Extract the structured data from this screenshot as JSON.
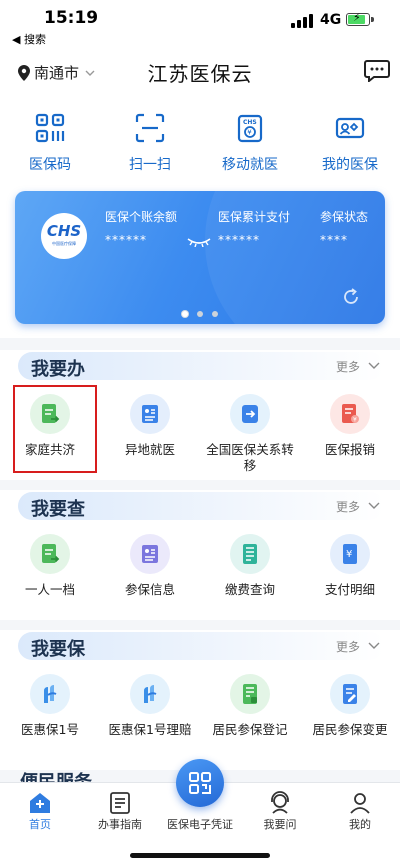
{
  "status_bar": {
    "time": "15:19",
    "back_label": "◀ 搜索",
    "network": "4G"
  },
  "header": {
    "city": "南通市",
    "title": "江苏医保云"
  },
  "quick_actions": [
    {
      "label": "医保码",
      "icon": "qr-code-icon"
    },
    {
      "label": "扫一扫",
      "icon": "scan-icon"
    },
    {
      "label": "移动就医",
      "icon": "mobile-medical-icon"
    },
    {
      "label": "我的医保",
      "icon": "insurance-card-icon"
    }
  ],
  "card": {
    "logo_text": "CHS",
    "logo_sub": "中国医疗保障",
    "columns": [
      {
        "label": "医保个账余额",
        "value": "******"
      },
      {
        "label": "医保累计支付",
        "value": "******"
      },
      {
        "label": "参保状态",
        "value": "****"
      }
    ],
    "page_count": 3,
    "active_page": 1
  },
  "sections": [
    {
      "title": "我要办",
      "more": "更多",
      "items": [
        {
          "label": "家庭共济",
          "icon": "family-mutual-aid-icon",
          "highlighted": true
        },
        {
          "label": "异地就医",
          "icon": "remote-medical-icon"
        },
        {
          "label": "全国医保关系转移",
          "icon": "transfer-icon"
        },
        {
          "label": "医保报销",
          "icon": "reimbursement-icon"
        }
      ]
    },
    {
      "title": "我要查",
      "more": "更多",
      "items": [
        {
          "label": "一人一档",
          "icon": "personal-file-icon"
        },
        {
          "label": "参保信息",
          "icon": "insurance-info-icon"
        },
        {
          "label": "缴费查询",
          "icon": "payment-query-icon"
        },
        {
          "label": "支付明细",
          "icon": "payment-detail-icon"
        }
      ]
    },
    {
      "title": "我要保",
      "more": "更多",
      "items": [
        {
          "label": "医惠保1号",
          "icon": "yihuibao-icon"
        },
        {
          "label": "医惠保1号理赔",
          "icon": "yihuibao-claim-icon"
        },
        {
          "label": "居民参保登记",
          "icon": "resident-register-icon"
        },
        {
          "label": "居民参保变更",
          "icon": "resident-change-icon"
        }
      ]
    }
  ],
  "service_peek": "便民服务",
  "bottom_nav": [
    {
      "label": "首页",
      "icon": "home-icon",
      "active": true
    },
    {
      "label": "办事指南",
      "icon": "guide-icon"
    },
    {
      "label": "医保电子凭证",
      "icon": "e-voucher-icon"
    },
    {
      "label": "我要问",
      "icon": "support-icon"
    },
    {
      "label": "我的",
      "icon": "profile-icon"
    }
  ],
  "colors": {
    "accent": "#2f7ce0",
    "highlight_border": "#d71d1d",
    "section_title": "#1d3350"
  }
}
